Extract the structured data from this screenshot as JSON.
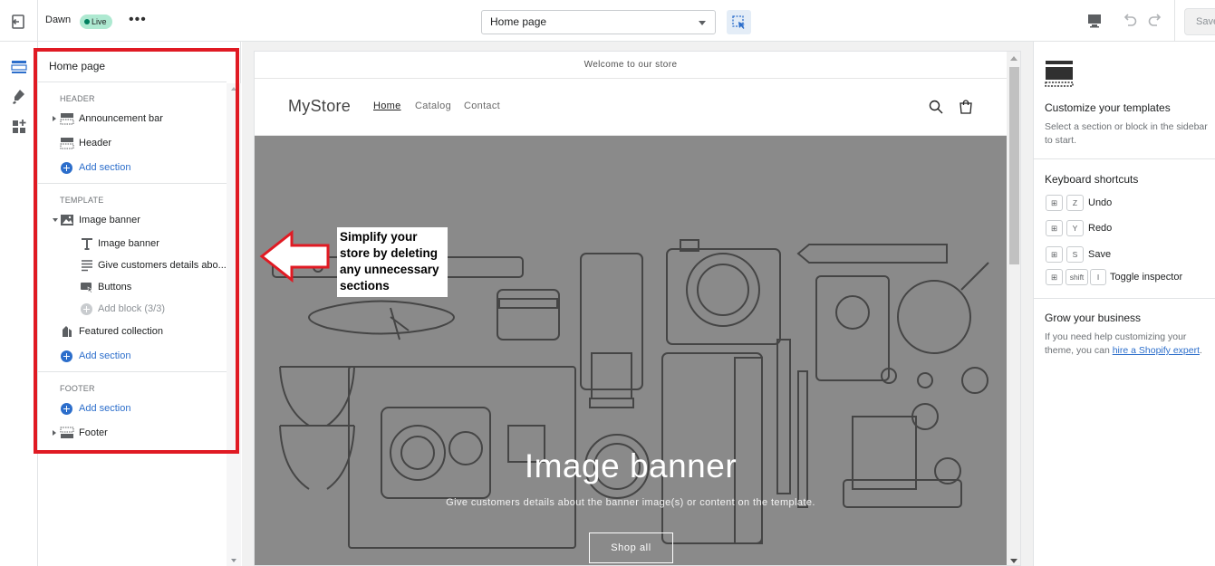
{
  "topbar": {
    "theme_name": "Dawn",
    "live_badge": "Live",
    "more_label": "•••",
    "page_select_value": "Home page",
    "save_label": "Save"
  },
  "sidebar": {
    "title": "Home page",
    "header_group": "HEADER",
    "template_group": "TEMPLATE",
    "footer_group": "FOOTER",
    "items": {
      "announcement_bar": "Announcement bar",
      "header": "Header",
      "add_section_header": "Add section",
      "image_banner": "Image banner",
      "block_image_banner": "Image banner",
      "block_give_customers": "Give customers details abo...",
      "block_buttons": "Buttons",
      "add_block": "Add block (3/3)",
      "featured_collection": "Featured collection",
      "add_section_template": "Add section",
      "add_section_footer": "Add section",
      "footer": "Footer"
    }
  },
  "preview": {
    "announcement": "Welcome to our store",
    "store_name": "MyStore",
    "nav": [
      "Home",
      "Catalog",
      "Contact"
    ],
    "banner_title": "Image banner",
    "banner_subtitle": "Give customers details about the banner image(s) or content on the template.",
    "shop_button": "Shop all"
  },
  "callout": {
    "text": "Simplify your store by deleting any unnecessary sections"
  },
  "right_panel": {
    "customize_title": "Customize your templates",
    "customize_text": "Select a section or block in the sidebar to start.",
    "shortcuts_title": "Keyboard shortcuts",
    "shortcuts": [
      {
        "mod": "⊞",
        "key": "Z",
        "label": "Undo"
      },
      {
        "mod": "⊞",
        "key": "Y",
        "label": "Redo"
      },
      {
        "mod": "⊞",
        "key": "S",
        "label": "Save"
      },
      {
        "mod": "⊞",
        "key2": "shift",
        "key": "I",
        "label": "Toggle inspector"
      }
    ],
    "grow_title": "Grow your business",
    "grow_text_before": "If you need help customizing your theme, you can ",
    "grow_link": "hire a Shopify expert",
    "grow_text_after": "."
  },
  "colors": {
    "accent": "#2c6ecb",
    "highlight_box": "#e01a23",
    "banner_overlay": "#8a8a8a",
    "live_badge": "#aee9d1"
  }
}
